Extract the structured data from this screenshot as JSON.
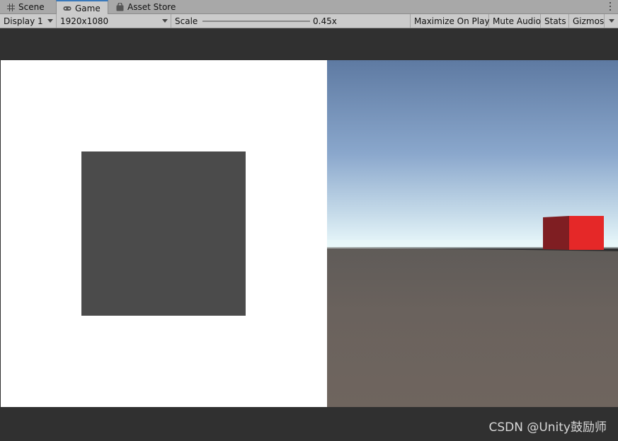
{
  "tabs": [
    {
      "label": "Scene",
      "icon": "grid-icon"
    },
    {
      "label": "Game",
      "icon": "gamepad-icon",
      "active": true
    },
    {
      "label": "Asset Store",
      "icon": "store-bag-icon"
    }
  ],
  "toolbar": {
    "display": "Display 1",
    "resolution": "1920x1080",
    "scale_label": "Scale",
    "scale_value": "0.45x",
    "maximize": "Maximize On Play",
    "mute": "Mute Audio",
    "stats": "Stats",
    "gizmos": "Gizmos"
  },
  "colors": {
    "accent": "#3a79bb",
    "sky_top": "#5e7aa2",
    "horizon": "#eaf9fb",
    "ground": "#6b625c",
    "cube_front": "#e52828",
    "cube_side": "#7f1e22",
    "ui_panel": "#4b4b4b"
  },
  "watermark": "CSDN @Unity鼓励师"
}
